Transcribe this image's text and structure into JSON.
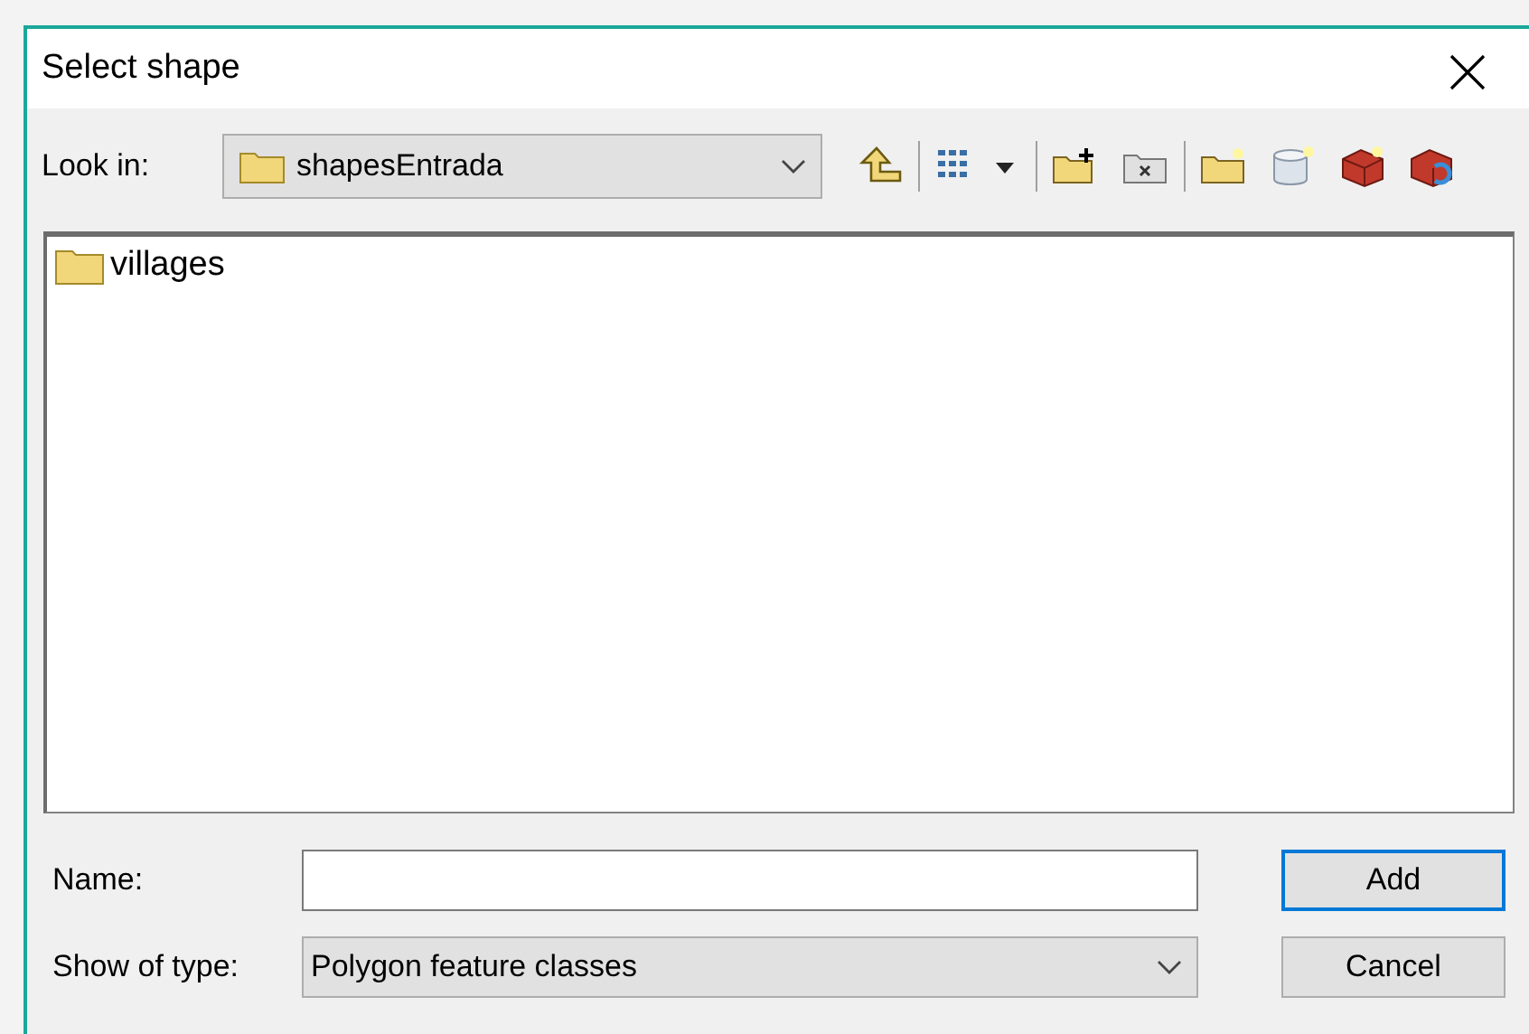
{
  "window": {
    "title": "Select shape"
  },
  "look_in": {
    "label": "Look in:",
    "value": "shapesEntrada"
  },
  "items": [
    {
      "name": "villages",
      "selected": false
    }
  ],
  "name_field": {
    "label": "Name:"
  },
  "type_field": {
    "label": "Show of type:",
    "value": "Polygon feature classes"
  },
  "buttons": [
    {
      "label": "Add",
      "default": true
    },
    {
      "label": "Cancel",
      "default": false
    }
  ]
}
